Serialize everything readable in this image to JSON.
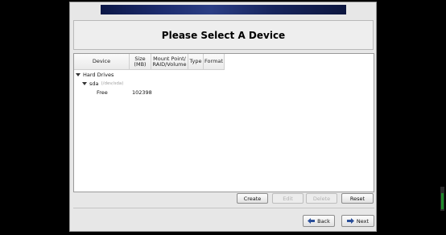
{
  "header": {
    "title": "Please Select A Device"
  },
  "table": {
    "columns": [
      "Device",
      "Size\n(MB)",
      "Mount Point/\nRAID/Volume",
      "Type",
      "Format"
    ],
    "tree": {
      "group_label": "Hard Drives",
      "drive_name": "sda",
      "drive_path": "(/dev/sda)",
      "partition_name": "Free",
      "partition_size": "102398"
    }
  },
  "actions": {
    "create": "Create",
    "edit": "Edit",
    "delete": "Delete",
    "reset": "Reset"
  },
  "nav": {
    "back": "Back",
    "next": "Next"
  },
  "colors": {
    "banner": "#1d2c6e",
    "arrow": "#2a4f9a",
    "slider": "#1f8a2a"
  }
}
